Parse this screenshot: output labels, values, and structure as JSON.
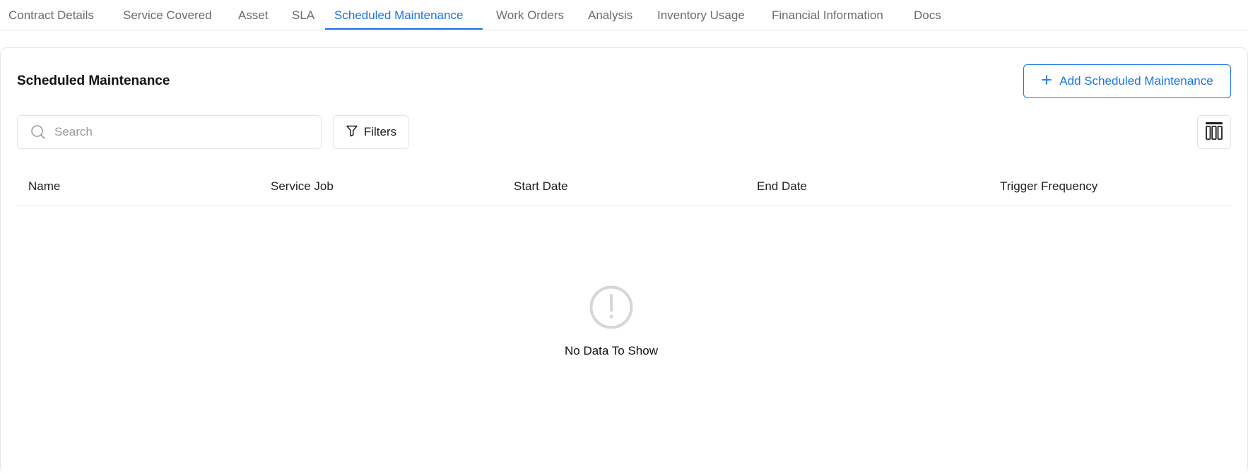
{
  "tabs": [
    {
      "label": "Contract Details"
    },
    {
      "label": "Service Covered"
    },
    {
      "label": "Asset"
    },
    {
      "label": "SLA"
    },
    {
      "label": "Scheduled Maintenance",
      "active": true
    },
    {
      "label": "Work Orders"
    },
    {
      "label": "Analysis"
    },
    {
      "label": "Inventory Usage"
    },
    {
      "label": "Financial Information"
    },
    {
      "label": "Docs"
    }
  ],
  "section": {
    "title": "Scheduled Maintenance",
    "add_button_label": "Add Scheduled Maintenance"
  },
  "search": {
    "placeholder": "Search",
    "value": ""
  },
  "filters": {
    "label": "Filters"
  },
  "table": {
    "columns": [
      "Name",
      "Service Job",
      "Start Date",
      "End Date",
      "Trigger Frequency"
    ],
    "rows": []
  },
  "empty_state": {
    "message": "No Data To Show"
  },
  "colors": {
    "accent": "#1a73e8",
    "tab_inactive": "#6b6b6b",
    "border": "#e6e6e6",
    "empty_icon": "#d6d6d6"
  },
  "icons": {
    "search": "search-icon",
    "filter": "filter-icon",
    "columns": "columns-icon",
    "plus": "plus-icon",
    "empty": "exclamation-circle-icon"
  }
}
